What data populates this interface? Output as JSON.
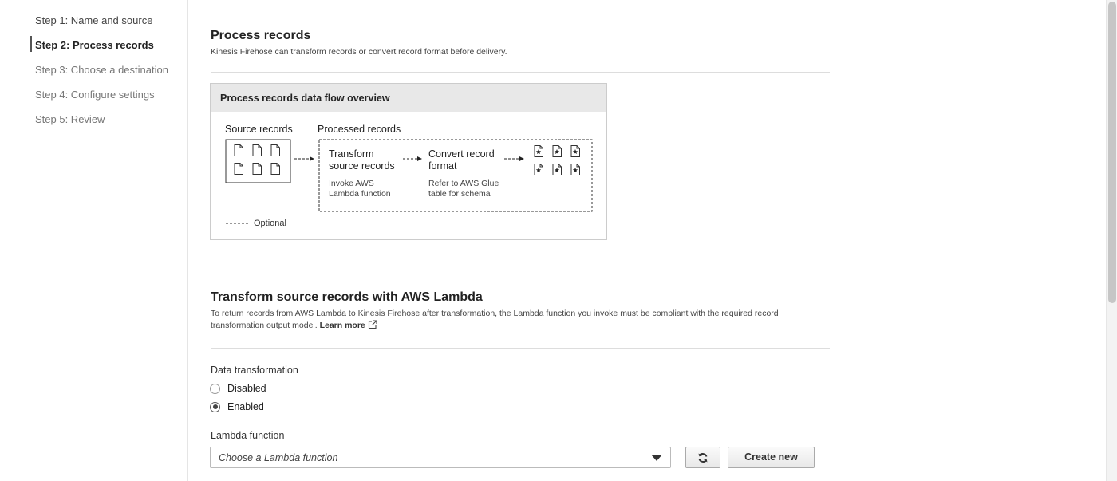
{
  "steps": [
    {
      "label": "Step 1: Name and source",
      "state": "done"
    },
    {
      "label": "Step 2: Process records",
      "state": "active"
    },
    {
      "label": "Step 3: Choose a destination",
      "state": "pending"
    },
    {
      "label": "Step 4: Configure settings",
      "state": "pending"
    },
    {
      "label": "Step 5: Review",
      "state": "pending"
    }
  ],
  "process": {
    "title": "Process records",
    "subtitle": "Kinesis Firehose can transform records or convert record format before delivery."
  },
  "overview": {
    "title": "Process records data flow overview",
    "source_label": "Source records",
    "processed_label": "Processed records",
    "transform_line1": "Transform",
    "transform_line2": "source records",
    "transform_desc1": "Invoke AWS",
    "transform_desc2": "Lambda function",
    "convert_line1": "Convert record",
    "convert_line2": "format",
    "convert_desc1": "Refer to AWS Glue",
    "convert_desc2": "table for schema",
    "legend_optional": "Optional"
  },
  "lambda": {
    "title": "Transform source records with AWS Lambda",
    "description": "To return records from AWS Lambda to Kinesis Firehose after transformation, the Lambda function you invoke must be compliant with the required record transformation output model.",
    "learn_more": "Learn more",
    "data_transformation_label": "Data transformation",
    "options": [
      {
        "label": "Disabled",
        "selected": false
      },
      {
        "label": "Enabled",
        "selected": true
      }
    ],
    "function_label": "Lambda function",
    "function_placeholder": "Choose a Lambda function",
    "create_new": "Create new",
    "refresh_icon": "refresh-icon"
  },
  "icons": {
    "external": "external-link-icon",
    "dropdown": "chevron-down-icon",
    "document": "document-icon",
    "processed_document": "starred-document-icon"
  },
  "colors": {
    "text": "#222222",
    "muted": "#777777",
    "panel_header": "#e8e8e8",
    "border": "#cccccc"
  }
}
